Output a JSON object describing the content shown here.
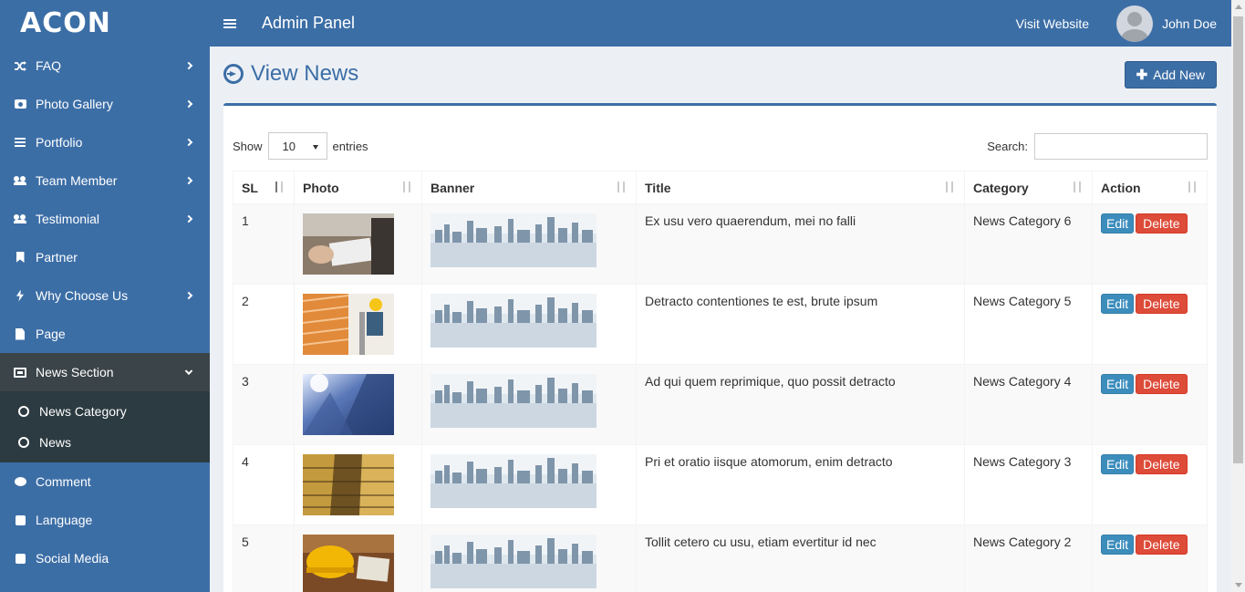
{
  "brand": {
    "logo": "ACON",
    "panel_title": "Admin Panel"
  },
  "header": {
    "visit_label": "Visit Website",
    "user_name": "John Doe"
  },
  "sidebar": {
    "items": [
      {
        "label": "FAQ",
        "icon": "shuffle-icon",
        "has_children": true
      },
      {
        "label": "Photo Gallery",
        "icon": "camera-icon",
        "has_children": true
      },
      {
        "label": "Portfolio",
        "icon": "bars-icon",
        "has_children": true
      },
      {
        "label": "Team Member",
        "icon": "users-icon",
        "has_children": true
      },
      {
        "label": "Testimonial",
        "icon": "user-plus-icon",
        "has_children": true
      },
      {
        "label": "Partner",
        "icon": "bookmark-icon",
        "has_children": false
      },
      {
        "label": "Why Choose Us",
        "icon": "bolt-icon",
        "has_children": true
      },
      {
        "label": "Page",
        "icon": "file-icon",
        "has_children": false
      },
      {
        "label": "News Section",
        "icon": "newspaper-icon",
        "has_children": true,
        "expanded": true
      },
      {
        "label": "Comment",
        "icon": "comment-icon",
        "has_children": false
      },
      {
        "label": "Language",
        "icon": "language-icon",
        "has_children": false
      },
      {
        "label": "Social Media",
        "icon": "address-book-icon",
        "has_children": false
      }
    ],
    "news_children": [
      "News Category",
      "News"
    ]
  },
  "page": {
    "title": "View News",
    "add_label": "Add New"
  },
  "table_controls": {
    "show_label": "Show",
    "entries_value": "10",
    "entries_label": "entries",
    "search_label": "Search:",
    "search_value": ""
  },
  "table": {
    "columns": [
      "SL",
      "Photo",
      "Banner",
      "Title",
      "Category",
      "Action"
    ],
    "rows": [
      {
        "sl": "1",
        "title": "Ex usu vero quaerendum, mei no falli",
        "category": "News Category 6",
        "photo_theme": "office-desk"
      },
      {
        "sl": "2",
        "title": "Detracto contentiones te est, brute ipsum",
        "category": "News Category 5",
        "photo_theme": "worker-ladder"
      },
      {
        "sl": "3",
        "title": "Ad qui quem reprimique, quo possit detracto",
        "category": "News Category 4",
        "photo_theme": "glass-building"
      },
      {
        "sl": "4",
        "title": "Pri et oratio iisque atomorum, enim detracto",
        "category": "News Category 3",
        "photo_theme": "golden-towers"
      },
      {
        "sl": "5",
        "title": "Tollit cetero cu usu, etiam evertitur id nec",
        "category": "News Category 2",
        "photo_theme": "hardhat-desk"
      }
    ],
    "edit_label": "Edit",
    "delete_label": "Delete"
  },
  "colors": {
    "primary": "#3c6ea6",
    "sidebar_active": "#2c3b41",
    "edit": "#3c8dbc",
    "delete": "#dd4b39"
  }
}
